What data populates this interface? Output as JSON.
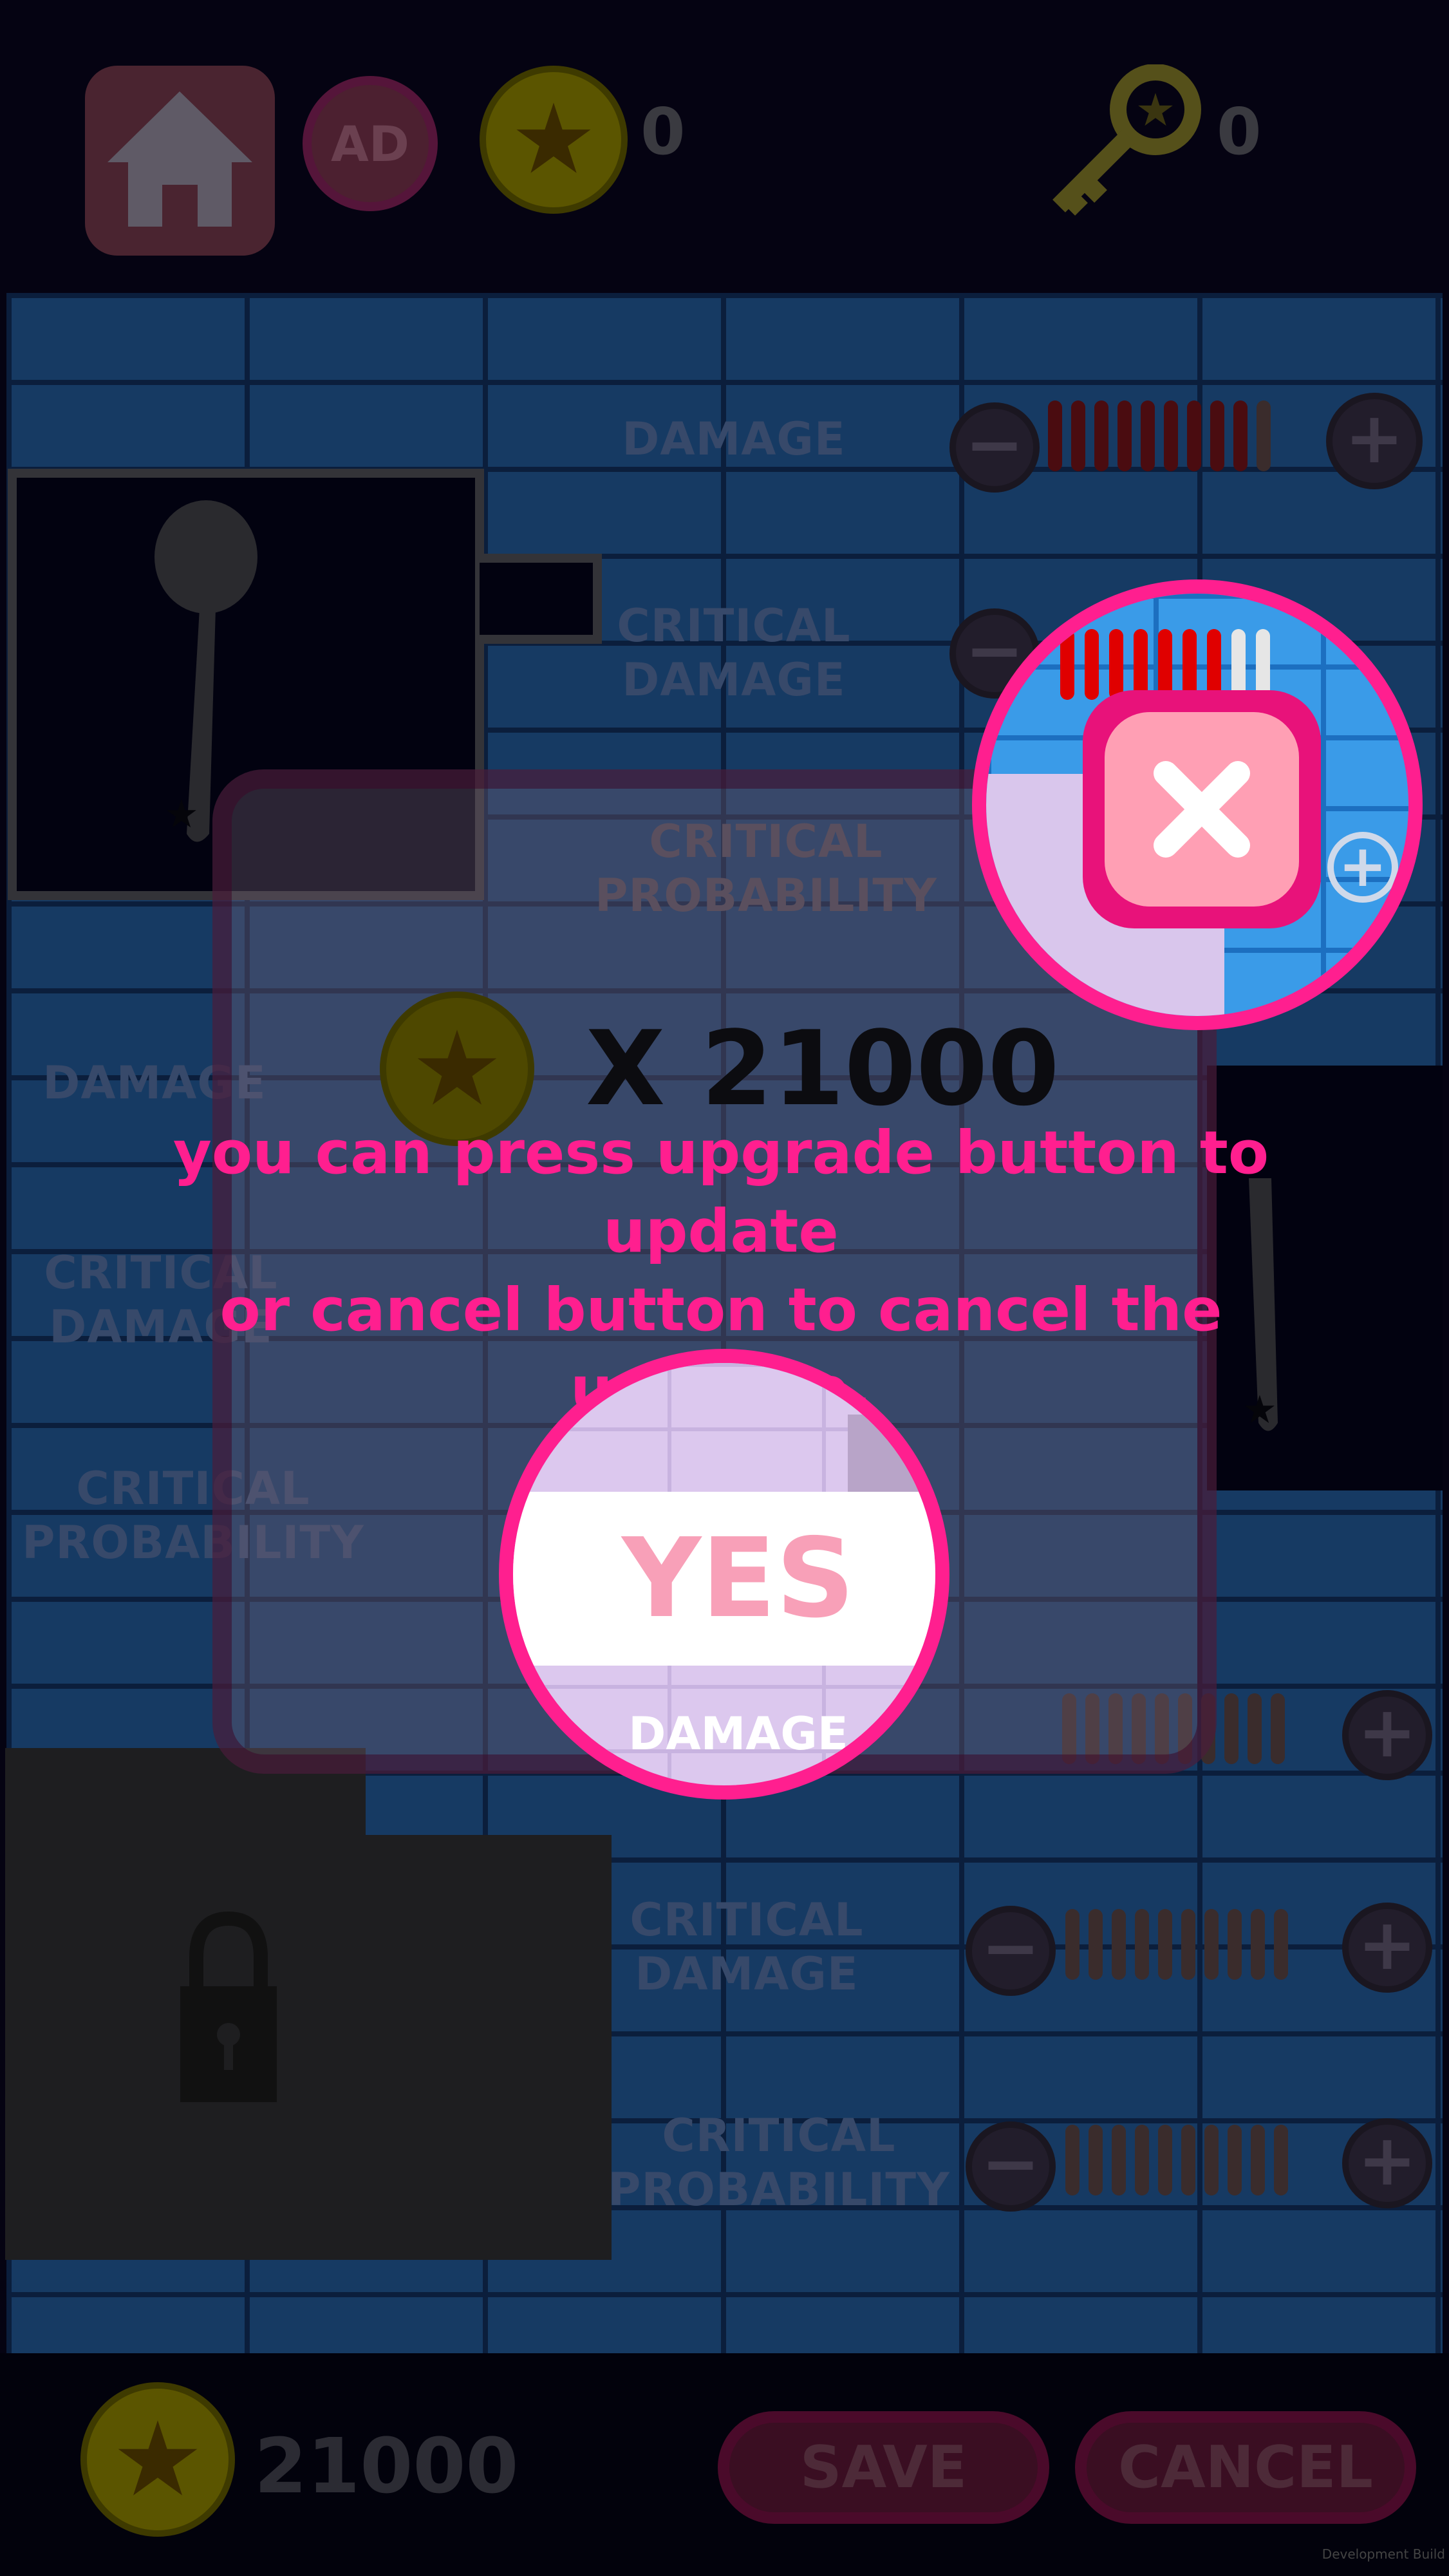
{
  "top_bar": {
    "ad_label": "AD",
    "coin_count": "0",
    "key_count": "0"
  },
  "upgrade_rows_top": [
    {
      "label1": "DAMAGE",
      "label2": ""
    },
    {
      "label1": "CRITICAL",
      "label2": "DAMAGE"
    },
    {
      "label1": "CRITICAL",
      "label2": "PROBABILITY"
    }
  ],
  "upgrade_rows_mid_left": [
    {
      "label1": "DAMAGE",
      "label2": ""
    },
    {
      "label1": "CRITICAL",
      "label2": "DAMAGE"
    },
    {
      "label1": "CRITICAL",
      "label2": "PROBABILITY"
    }
  ],
  "upgrade_rows_bottom": [
    {
      "label1": "CRITICAL",
      "label2": "DAMAGE"
    },
    {
      "label1": "CRITICAL",
      "label2": "PROBABILITY"
    }
  ],
  "dialog": {
    "price_prefix": "X",
    "price": "21000",
    "yes_label": "YES"
  },
  "tutorial": {
    "line1": "you can press upgrade button to update",
    "line2": "or cancel button to cancel the upgrade.",
    "zoom_under_label": "DAMAGE"
  },
  "bottom_bar": {
    "total_coins": "21000",
    "save_label": "SAVE",
    "cancel_label": "CANCEL"
  },
  "footer": {
    "build_label": "Development Build"
  },
  "colors": {
    "highlight_pink": "#ff1f8f",
    "close_button": "#ff9fb4",
    "yes_text": "#f8a0b8",
    "brick_blue": "#163a63"
  }
}
